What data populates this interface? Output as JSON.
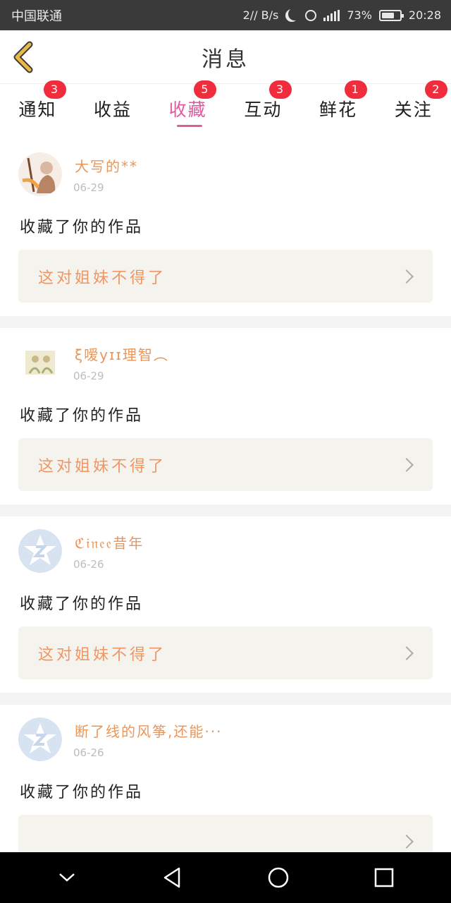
{
  "status_bar": {
    "carrier": "中国联通",
    "net_speed": "2// B/s",
    "battery": "73%",
    "battery_level": 0.73,
    "time": "20:28"
  },
  "header": {
    "title": "消息"
  },
  "tabs": [
    {
      "label": "通知",
      "badge": "3",
      "active": false
    },
    {
      "label": "收益",
      "badge": "",
      "active": false
    },
    {
      "label": "收藏",
      "badge": "5",
      "active": true
    },
    {
      "label": "互动",
      "badge": "3",
      "active": false
    },
    {
      "label": "鲜花",
      "badge": "1",
      "active": false
    },
    {
      "label": "关注",
      "badge": "2",
      "active": false
    }
  ],
  "feed": [
    {
      "name": "大写的**",
      "date": "06-29",
      "action": "收藏了你的作品",
      "work_title": "这对姐妹不得了"
    },
    {
      "name": "ξ嗳yɪɪ理智︵",
      "date": "06-29",
      "action": "收藏了你的作品",
      "work_title": "这对姐妹不得了"
    },
    {
      "name": "ℭ𝔦𝔫𝔢𝔢昔年",
      "date": "06-26",
      "action": "收藏了你的作品",
      "work_title": "这对姐妹不得了"
    },
    {
      "name": "断了线的风筝,还能···",
      "date": "06-26",
      "action": "收藏了你的作品",
      "work_title": ""
    }
  ],
  "colors": {
    "accent_pink": "#e05aa0",
    "badge_red": "#f02d3d",
    "name_orange": "#e9965a",
    "work_orange": "#ee9664",
    "back_yellow": "#e8b84a"
  }
}
